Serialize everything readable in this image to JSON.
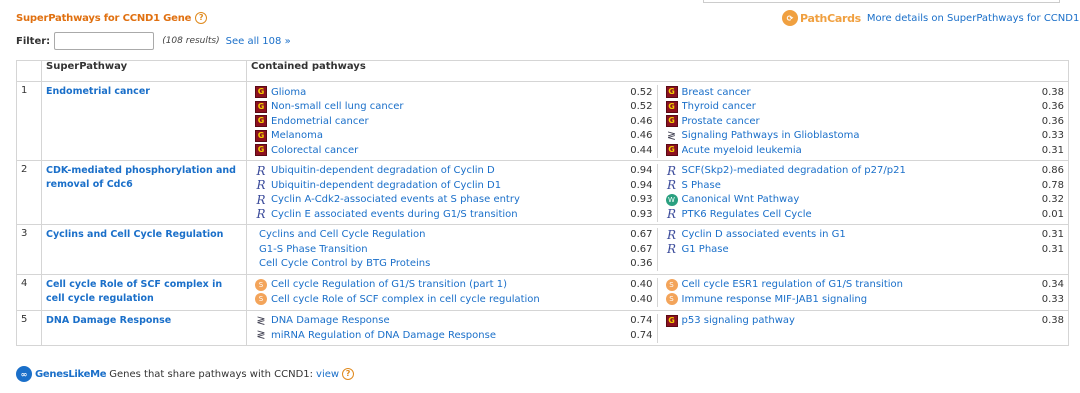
{
  "header": {
    "title": "SuperPathways for CCND1 Gene",
    "pathcards_logo": "PathCards",
    "more_link": "More details on SuperPathways for CCND1"
  },
  "filter": {
    "label": "Filter:",
    "value": "",
    "placeholder": "",
    "results": "(108 results)",
    "see_all": "See all 108 »"
  },
  "table": {
    "col_superpathway": "SuperPathway",
    "col_contained": "Contained pathways",
    "rows": [
      {
        "num": "1",
        "name": "Endometrial cancer",
        "left": [
          {
            "icon": "kegg-icon",
            "name": "Glioma",
            "score": "0.52"
          },
          {
            "icon": "kegg-icon",
            "name": "Non-small cell lung cancer",
            "score": "0.52"
          },
          {
            "icon": "kegg-icon",
            "name": "Endometrial cancer",
            "score": "0.46"
          },
          {
            "icon": "kegg-icon",
            "name": "Melanoma",
            "score": "0.46"
          },
          {
            "icon": "kegg-icon",
            "name": "Colorectal cancer",
            "score": "0.44"
          }
        ],
        "right": [
          {
            "icon": "kegg-icon",
            "name": "Breast cancer",
            "score": "0.38"
          },
          {
            "icon": "kegg-icon",
            "name": "Thyroid cancer",
            "score": "0.36"
          },
          {
            "icon": "kegg-icon",
            "name": "Prostate cancer",
            "score": "0.36"
          },
          {
            "icon": "wikipathways-icon",
            "name": "Signaling Pathways in Glioblastoma",
            "score": "0.33"
          },
          {
            "icon": "kegg-icon",
            "name": "Acute myeloid leukemia",
            "score": "0.31"
          }
        ]
      },
      {
        "num": "2",
        "name": "CDK-mediated phosphorylation and removal of Cdc6",
        "left": [
          {
            "icon": "reactome-icon",
            "name": "Ubiquitin-dependent degradation of Cyclin D",
            "score": "0.94"
          },
          {
            "icon": "reactome-icon",
            "name": "Ubiquitin-dependent degradation of Cyclin D1",
            "score": "0.94"
          },
          {
            "icon": "reactome-icon",
            "name": "Cyclin A-Cdk2-associated events at S phase entry",
            "score": "0.93"
          },
          {
            "icon": "reactome-icon",
            "name": "Cyclin E associated events during G1/S transition",
            "score": "0.93"
          }
        ],
        "right": [
          {
            "icon": "reactome-icon",
            "name": "SCF(Skp2)-mediated degradation of p27/p21",
            "score": "0.86"
          },
          {
            "icon": "reactome-icon",
            "name": "S Phase",
            "score": "0.78"
          },
          {
            "icon": "wnt-icon",
            "name": "Canonical Wnt Pathway",
            "score": "0.32"
          },
          {
            "icon": "reactome-icon",
            "name": "PTK6 Regulates Cell Cycle",
            "score": "0.01"
          }
        ]
      },
      {
        "num": "3",
        "name": "Cyclins and Cell Cycle Regulation",
        "left": [
          {
            "icon": "none",
            "name": "Cyclins and Cell Cycle Regulation",
            "score": "0.67"
          },
          {
            "icon": "none",
            "name": "G1-S Phase Transition",
            "score": "0.67"
          },
          {
            "icon": "none",
            "name": "Cell Cycle Control by BTG Proteins",
            "score": "0.36"
          }
        ],
        "right": [
          {
            "icon": "reactome-icon",
            "name": "Cyclin D associated events in G1",
            "score": "0.31"
          },
          {
            "icon": "reactome-icon",
            "name": "G1 Phase",
            "score": "0.31"
          }
        ]
      },
      {
        "num": "4",
        "name": "Cell cycle Role of SCF complex in cell cycle regulation",
        "left": [
          {
            "icon": "orange-icon",
            "name": "Cell cycle Regulation of G1/S transition (part 1)",
            "score": "0.40"
          },
          {
            "icon": "orange-icon",
            "name": "Cell cycle Role of SCF complex in cell cycle regulation",
            "score": "0.40"
          }
        ],
        "right": [
          {
            "icon": "orange-icon",
            "name": "Cell cycle ESR1 regulation of G1/S transition",
            "score": "0.34"
          },
          {
            "icon": "orange-icon",
            "name": "Immune response MIF-JAB1 signaling",
            "score": "0.33"
          }
        ]
      },
      {
        "num": "5",
        "name": "DNA Damage Response",
        "left": [
          {
            "icon": "wikipathways-icon",
            "name": "DNA Damage Response",
            "score": "0.74"
          },
          {
            "icon": "wikipathways-icon",
            "name": "miRNA Regulation of DNA Damage Response",
            "score": "0.74"
          }
        ],
        "right": [
          {
            "icon": "kegg-icon",
            "name": "p53 signaling pathway",
            "score": "0.38"
          }
        ]
      }
    ]
  },
  "footer": {
    "logo": "GenesLikeMe",
    "text": "Genes that share pathways with CCND1:",
    "view": "view"
  }
}
